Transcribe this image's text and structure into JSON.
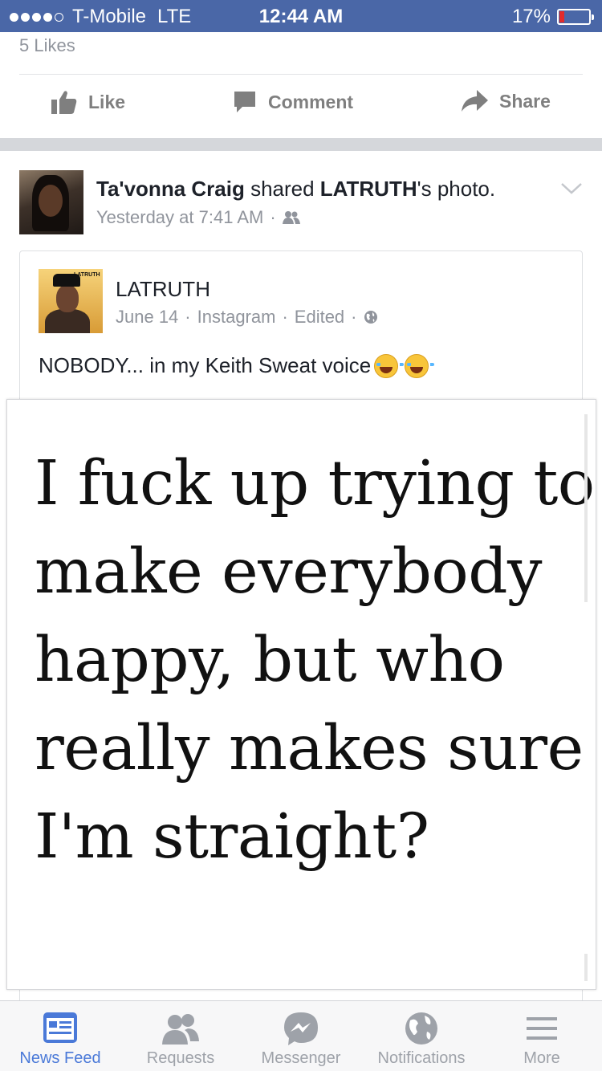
{
  "status_bar": {
    "carrier": "T-Mobile",
    "network": "LTE",
    "time": "12:44 AM",
    "battery": "17%",
    "signal_dots_filled": 4,
    "signal_dots_total": 5
  },
  "previous_post": {
    "likes": "5 Likes",
    "actions": {
      "like": "Like",
      "comment": "Comment",
      "share": "Share"
    }
  },
  "post": {
    "author": "Ta'vonna Craig",
    "shared_text": " shared ",
    "source_owner": "LATRUTH",
    "source_suffix": "'s photo.",
    "timestamp": "Yesterday at 7:41 AM",
    "separator": "·",
    "audience_icon": "friends-icon",
    "shared_post": {
      "name": "LATRUTH",
      "avatar_label": "LATRUTH",
      "date": "June 14",
      "via": "Instagram",
      "edited": "Edited",
      "privacy_icon": "globe-icon",
      "caption": "NOBODY... in my Keith Sweat voice",
      "caption_emojis": [
        "tears-of-joy-emoji",
        "tears-of-joy-emoji"
      ],
      "image_text_lines": [
        "I fuck up trying to",
        "make everybody",
        "happy, but who",
        "really makes sure",
        "I'm straight?"
      ]
    }
  },
  "tab_bar": {
    "items": [
      {
        "label": "News Feed",
        "icon": "news-feed-icon",
        "active": true
      },
      {
        "label": "Requests",
        "icon": "requests-icon",
        "active": false
      },
      {
        "label": "Messenger",
        "icon": "messenger-icon",
        "active": false
      },
      {
        "label": "Notifications",
        "icon": "globe-icon",
        "active": false
      },
      {
        "label": "More",
        "icon": "menu-icon",
        "active": false
      }
    ]
  },
  "colors": {
    "status_bar": "#4a67a7",
    "active_tab": "#4a79d8",
    "inactive_tab": "#9ea2a9",
    "meta_text": "#90949c"
  }
}
